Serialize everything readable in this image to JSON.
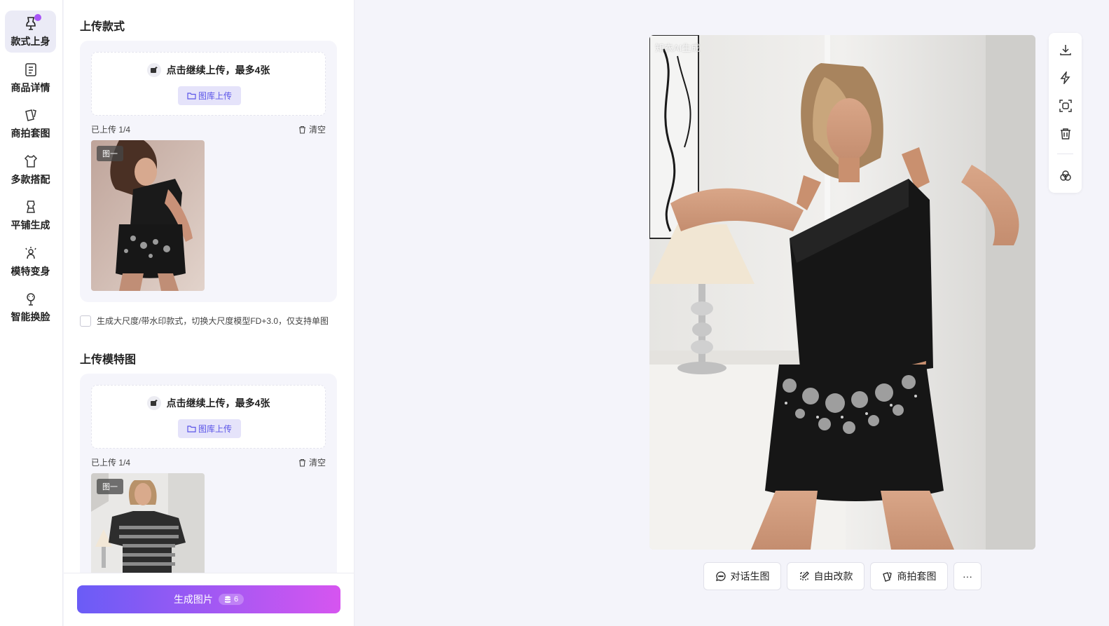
{
  "sidebar": {
    "items": [
      {
        "label": "款式上身",
        "icon": "dress-form-icon",
        "active": true
      },
      {
        "label": "商品详情",
        "icon": "document-icon",
        "active": false
      },
      {
        "label": "商拍套图",
        "icon": "cards-icon",
        "active": false
      },
      {
        "label": "多款搭配",
        "icon": "shirt-icon",
        "active": false
      },
      {
        "label": "平铺生成",
        "icon": "flat-lay-icon",
        "active": false
      },
      {
        "label": "模特变身",
        "icon": "sparkle-person-icon",
        "active": false
      },
      {
        "label": "智能换脸",
        "icon": "face-swap-icon",
        "active": false
      }
    ]
  },
  "panel": {
    "style_section": {
      "title": "上传款式",
      "dropzone_text": "点击继续上传，最多4张",
      "library_button": "图库上传",
      "uploaded_status": "已上传 1/4",
      "clear_label": "清空",
      "thumb_tag": "图一"
    },
    "checkbox_label": "生成大尺度/带水印款式，切换大尺度模型FD+3.0，仅支持单图",
    "model_section": {
      "title": "上传模特图",
      "dropzone_text": "点击继续上传，最多4张",
      "library_button": "图库上传",
      "uploaded_status": "已上传 1/4",
      "clear_label": "清空",
      "thumb_tag": "图一"
    },
    "generate": {
      "label": "生成图片",
      "cost": "6"
    }
  },
  "preview": {
    "watermark": "知衣AI生成"
  },
  "toolbar": {
    "tools": [
      "download-icon",
      "lightning-icon",
      "scan-icon",
      "trash-icon",
      "blend-icon"
    ]
  },
  "actions": {
    "chat": "对话生图",
    "edit": "自由改款",
    "set": "商拍套图",
    "more": "···"
  },
  "colors": {
    "accent": "#6a5cf6",
    "accent_end": "#d655f0",
    "badge_dot": "#a855f7"
  }
}
